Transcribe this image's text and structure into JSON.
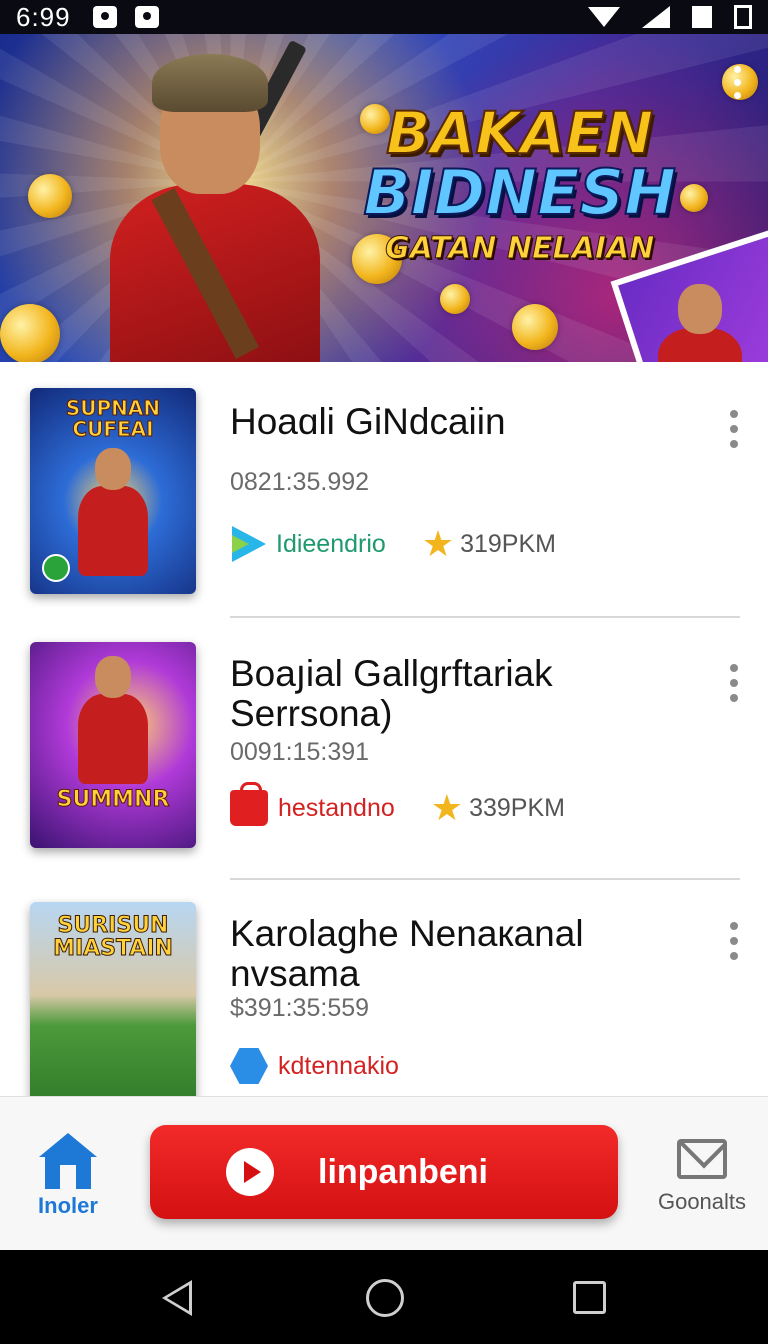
{
  "status_bar": {
    "time": "6:99"
  },
  "banner": {
    "title_line1": "BAKAEN",
    "title_line2": "BIDNESH",
    "subtitle": "GATAN NELAIAN"
  },
  "items": [
    {
      "thumb_text": "SUPNAN CUFEAI",
      "title": "Hoaɑli GiNdcaiin",
      "time": "0821:35.992",
      "publisher": "Idieendrio",
      "publisher_icon": "play-store-icon",
      "rating": "319PKM"
    },
    {
      "thumb_text": "SUMMNR",
      "title": "Boaյial Gallgrftariak Serrsona)",
      "time": "0091:15:391",
      "publisher": "hestandno",
      "publisher_icon": "bag-icon",
      "rating": "339PKM"
    },
    {
      "thumb_text": "SURISUN MIASTAIN",
      "title": "Karolaghe Nenaкanal nvsama",
      "time": "$391:35:559",
      "publisher": "kdtennakio",
      "publisher_icon": "hex-icon"
    }
  ],
  "bottom_nav": {
    "home_label": "Inoler",
    "cta_label": "linpanbeni",
    "goals_label": "Goonalts"
  },
  "colors": {
    "accent_red": "#d41010",
    "accent_blue": "#1e78d6",
    "star": "#f2b51d"
  }
}
